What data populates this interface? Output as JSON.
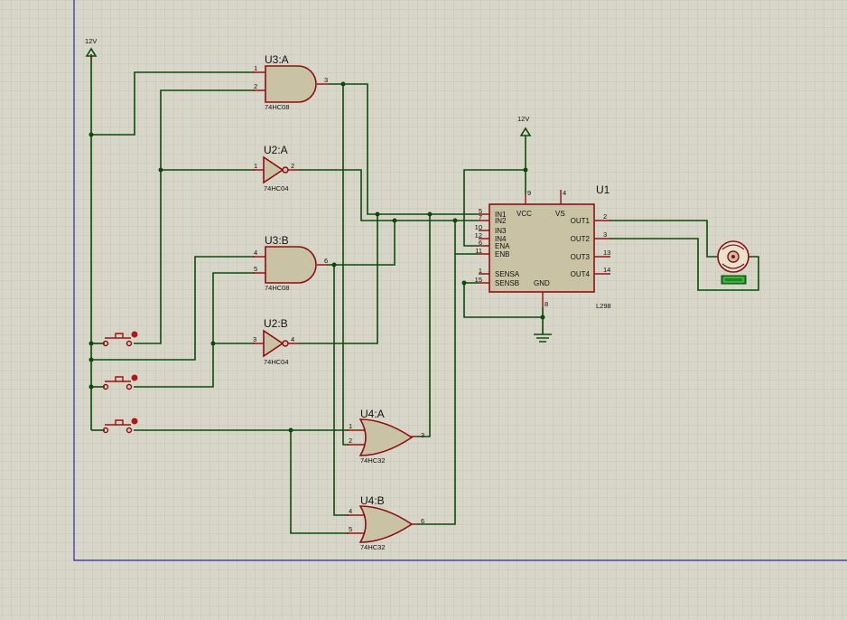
{
  "power": {
    "left_label": "12V",
    "driver_label": "12V"
  },
  "gates": {
    "u3a": {
      "ref": "U3:A",
      "value": "74HC08",
      "pins": [
        "1",
        "2",
        "3"
      ]
    },
    "u2a": {
      "ref": "U2:A",
      "value": "74HC04",
      "pins": [
        "1",
        "2"
      ]
    },
    "u3b": {
      "ref": "U3:B",
      "value": "74HC08",
      "pins": [
        "4",
        "5",
        "6"
      ]
    },
    "u2b": {
      "ref": "U2:B",
      "value": "74HC04",
      "pins": [
        "3",
        "4"
      ]
    },
    "u4a": {
      "ref": "U4:A",
      "value": "74HC32",
      "pins": [
        "1",
        "2",
        "3"
      ]
    },
    "u4b": {
      "ref": "U4:B",
      "value": "74HC32",
      "pins": [
        "4",
        "5",
        "6"
      ]
    }
  },
  "driver": {
    "ref": "U1",
    "value": "L298",
    "left_pins": [
      {
        "num": "5",
        "name": "IN1"
      },
      {
        "num": "7",
        "name": "IN2"
      },
      {
        "num": "10",
        "name": "IN3"
      },
      {
        "num": "12",
        "name": "IN4"
      },
      {
        "num": "6",
        "name": "ENA"
      },
      {
        "num": "11",
        "name": "ENB"
      },
      {
        "num": "1",
        "name": "SENSA"
      },
      {
        "num": "15",
        "name": "SENSB"
      }
    ],
    "right_pins": [
      {
        "num": "2",
        "name": "OUT1"
      },
      {
        "num": "3",
        "name": "OUT2"
      },
      {
        "num": "13",
        "name": "OUT3"
      },
      {
        "num": "14",
        "name": "OUT4"
      }
    ],
    "top_pins": [
      {
        "num": "9",
        "name": "VCC"
      },
      {
        "num": "4",
        "name": "VS"
      }
    ],
    "bottom_pin": {
      "num": "8",
      "name": "GND"
    }
  },
  "colors": {
    "background": "#d8d6c8",
    "grid_minor": "#c4c2b3",
    "grid_major": "#b3b1a2",
    "border": "#2828a8",
    "wire": "#0c4a0c",
    "component_outline": "#8a1010",
    "component_fill": "#c9c2a4",
    "motor_indicator": "#1d8a1d"
  }
}
